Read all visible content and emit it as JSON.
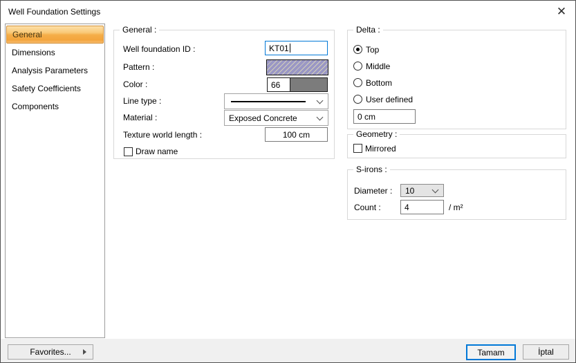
{
  "window": {
    "title": "Well Foundation Settings",
    "close_icon": "✕"
  },
  "sidebar": {
    "items": [
      {
        "label": "General",
        "selected": true
      },
      {
        "label": "Dimensions",
        "selected": false
      },
      {
        "label": "Analysis Parameters",
        "selected": false
      },
      {
        "label": "Safety Coefficients",
        "selected": false
      },
      {
        "label": "Components",
        "selected": false
      }
    ]
  },
  "general": {
    "legend": "General :",
    "well_foundation_id": {
      "label": "Well foundation ID :",
      "value": "KT01"
    },
    "pattern": {
      "label": "Pattern :"
    },
    "color": {
      "label": "Color :",
      "value": "66",
      "swatch": "#7c7c7c"
    },
    "line_type": {
      "label": "Line type :"
    },
    "material": {
      "label": "Material :",
      "value": "Exposed Concrete"
    },
    "texture_world_length": {
      "label": "Texture world length :",
      "value": "100 cm"
    },
    "draw_name": {
      "label": "Draw name",
      "checked": false
    }
  },
  "delta": {
    "legend": "Delta :",
    "options": [
      {
        "label": "Top",
        "selected": true
      },
      {
        "label": "Middle",
        "selected": false
      },
      {
        "label": "Bottom",
        "selected": false
      },
      {
        "label": "User defined",
        "selected": false
      }
    ],
    "value": "0 cm"
  },
  "geometry": {
    "legend": "Geometry :",
    "mirrored": {
      "label": "Mirrored",
      "checked": false
    }
  },
  "s_irons": {
    "legend": "S-irons :",
    "diameter": {
      "label": "Diameter :",
      "value": "10"
    },
    "count": {
      "label": "Count :",
      "value": "4",
      "unit": "/ m²"
    }
  },
  "footer": {
    "favorites": "Favorites...",
    "ok": "Tamam",
    "cancel": "İptal"
  },
  "colors": {
    "accent": "#0078d7",
    "selection_border": "#d2913b",
    "pattern_fill": "#9a97c5",
    "color_swatch": "#7c7c7c"
  }
}
